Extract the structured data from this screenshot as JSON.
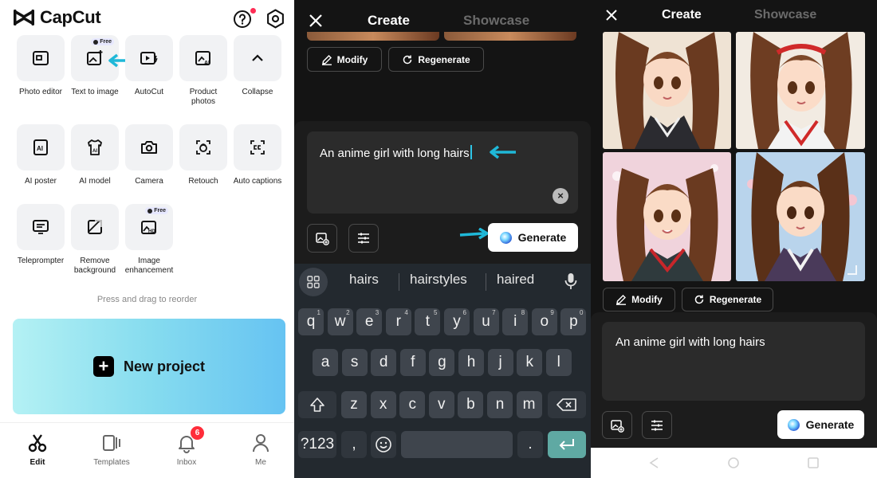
{
  "panel1": {
    "app_name": "CapCut",
    "tools": [
      {
        "label": "Photo editor",
        "icon": "photo-editor-icon"
      },
      {
        "label": "Text to image",
        "icon": "text-to-image-icon",
        "badge": "Free"
      },
      {
        "label": "AutoCut",
        "icon": "autocut-icon"
      },
      {
        "label": "Product photos",
        "icon": "product-photos-icon"
      },
      {
        "label": "Collapse",
        "icon": "chevron-up-icon"
      },
      {
        "label": "AI poster",
        "icon": "ai-poster-icon"
      },
      {
        "label": "AI model",
        "icon": "ai-model-icon"
      },
      {
        "label": "Camera",
        "icon": "camera-icon"
      },
      {
        "label": "Retouch",
        "icon": "retouch-icon"
      },
      {
        "label": "Auto captions",
        "icon": "auto-captions-icon"
      },
      {
        "label": "Teleprompter",
        "icon": "teleprompter-icon"
      },
      {
        "label": "Remove background",
        "icon": "remove-background-icon"
      },
      {
        "label": "Image enhancement",
        "icon": "image-enhancement-icon",
        "badge": "Free"
      }
    ],
    "hint": "Press and drag to reorder",
    "new_project": "New project",
    "nav": [
      {
        "label": "Edit",
        "icon": "scissors-icon",
        "active": true
      },
      {
        "label": "Templates",
        "icon": "templates-icon",
        "active": false
      },
      {
        "label": "Inbox",
        "icon": "bell-icon",
        "active": false,
        "badge": "6"
      },
      {
        "label": "Me",
        "icon": "person-icon",
        "active": false
      }
    ]
  },
  "panel2": {
    "tabs": {
      "create": "Create",
      "showcase": "Showcase"
    },
    "modify": "Modify",
    "regenerate": "Regenerate",
    "prompt": "An anime girl with long hairs",
    "generate": "Generate",
    "suggestions": [
      "hairs",
      "hairstyles",
      "haired"
    ],
    "keyboard": {
      "row1": [
        "q",
        "w",
        "e",
        "r",
        "t",
        "y",
        "u",
        "i",
        "o",
        "p"
      ],
      "row1_hints": [
        "1",
        "2",
        "3",
        "4",
        "5",
        "6",
        "7",
        "8",
        "9",
        "0"
      ],
      "row2": [
        "a",
        "s",
        "d",
        "f",
        "g",
        "h",
        "j",
        "k",
        "l"
      ],
      "row3": [
        "z",
        "x",
        "c",
        "v",
        "b",
        "n",
        "m"
      ],
      "symbols": "?123",
      "comma": ",",
      "period": "."
    }
  },
  "panel3": {
    "tabs": {
      "create": "Create",
      "showcase": "Showcase"
    },
    "modify": "Modify",
    "regenerate": "Regenerate",
    "prompt": "An anime girl with long hairs",
    "generate": "Generate"
  },
  "colors": {
    "accent_cyan": "#1fb8d8",
    "dark_bg": "#141414",
    "badge_red": "#ff2d3a"
  }
}
